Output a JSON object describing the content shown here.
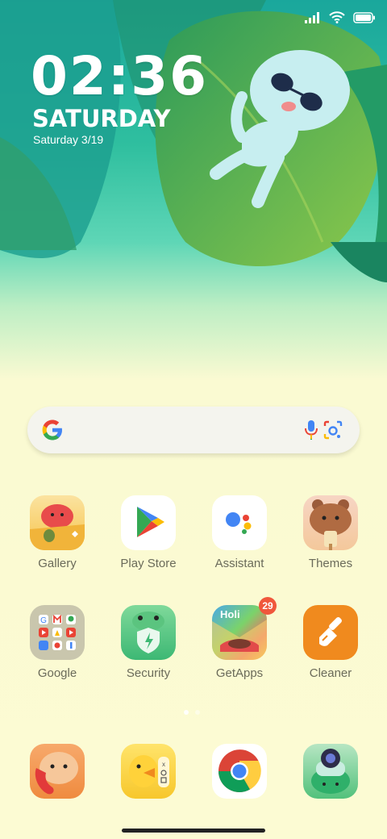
{
  "status_bar": {
    "icons": [
      "signal-icon",
      "wifi-icon",
      "battery-icon"
    ]
  },
  "lock_widget": {
    "time": "02:36",
    "day": "SATURDAY",
    "date": "Saturday 3/19"
  },
  "search_bar": {
    "icons": [
      "google-g-icon",
      "microphone-icon",
      "camera-lens-icon"
    ]
  },
  "apps_row1": [
    {
      "label": "Gallery",
      "icon": "gallery-icon"
    },
    {
      "label": "Play Store",
      "icon": "play-store-icon"
    },
    {
      "label": "Assistant",
      "icon": "assistant-icon"
    },
    {
      "label": "Themes",
      "icon": "themes-icon"
    }
  ],
  "apps_row2": [
    {
      "label": "Google",
      "icon": "google-folder-icon"
    },
    {
      "label": "Security",
      "icon": "security-icon"
    },
    {
      "label": "GetApps",
      "icon": "getapps-icon",
      "badge": "29",
      "badge_text": "Holi"
    },
    {
      "label": "Cleaner",
      "icon": "cleaner-icon"
    }
  ],
  "dock": [
    {
      "icon": "phone-icon"
    },
    {
      "icon": "messages-icon"
    },
    {
      "icon": "chrome-icon"
    },
    {
      "icon": "camera-icon"
    }
  ],
  "colors": {
    "background": "#fcfbd3",
    "label": "#6b6b5a",
    "badge": "#f0573c",
    "cleaner": "#f08a1e"
  }
}
